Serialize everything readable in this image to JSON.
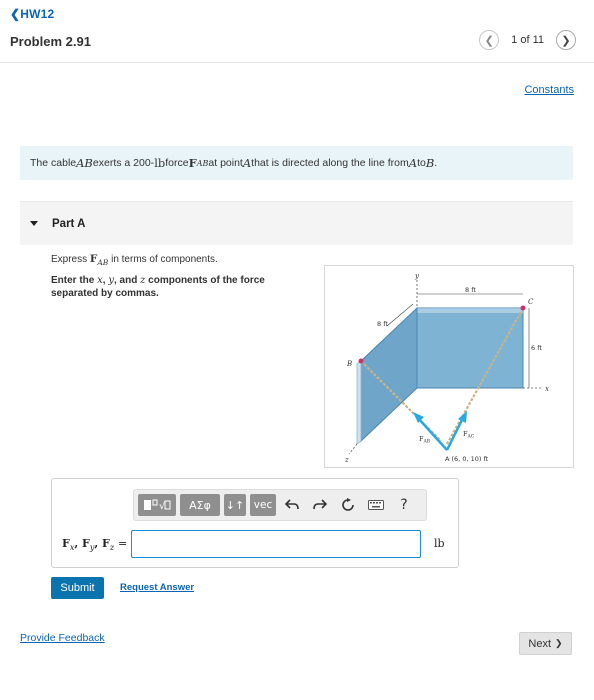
{
  "header": {
    "back_label": "HW12",
    "problem_title": "Problem 2.91",
    "pager": {
      "count": "1 of 11",
      "prev_icon": "chevron-left",
      "next_icon": "chevron-right"
    }
  },
  "constants_link": "Constants",
  "statement": {
    "t1": "The cable ",
    "m1": "AB",
    "t2": " exerts a 200-",
    "unit": "lb",
    "t3": " force ",
    "force": "F",
    "force_sub": "AB",
    "t4": " at point ",
    "m2": "A",
    "t5": " that is directed along the line from ",
    "m3": "A",
    "t6": " to ",
    "m4": "B",
    "t7": "."
  },
  "part": {
    "title": "Part A",
    "caret": "caret-down"
  },
  "express": {
    "t1": "Express ",
    "force": "F",
    "force_sub": "AB",
    "t2": " in terms of components."
  },
  "instruction": {
    "t1": "Enter the ",
    "x": "x",
    "c1": ", ",
    "y": "y",
    "c2": ", and ",
    "z": "z",
    "t2": " components of the force separated by commas."
  },
  "figure": {
    "labels": {
      "y": "y",
      "x": "x",
      "z": "z",
      "dim_8ft_top": "8 ft",
      "dim_8ft_side": "8 ft",
      "dim_6ft": "6 ft",
      "B": "B",
      "C": "C",
      "FAB": "F",
      "FAB_sub": "AB",
      "FAC": "F",
      "FAC_sub": "AC",
      "A_coord": "A (6, 0, 10) ft"
    },
    "colors": {
      "wall": "#7fb3d3",
      "wall_edge": "#4a87b0",
      "arrow": "#29a9e0",
      "cable": "#c8b48a",
      "point": "#d0306a"
    }
  },
  "toolbar": {
    "templates_icon": "templates-icon",
    "greek_label": "ΑΣφ",
    "arrows_label": "↓↑",
    "vec_label": "vec",
    "undo_icon": "undo-icon",
    "redo_icon": "redo-icon",
    "reset_icon": "reset-icon",
    "keyboard_icon": "keyboard-icon",
    "help_label": "?"
  },
  "answer": {
    "label_F": "F",
    "sub_x": "x",
    "sub_y": "y",
    "sub_z": "z",
    "sep": ", ",
    "equals": "=",
    "value": "",
    "unit": "lb"
  },
  "buttons": {
    "submit": "Submit",
    "request_answer": "Request Answer",
    "provide_feedback": "Provide Feedback",
    "next": "Next"
  }
}
